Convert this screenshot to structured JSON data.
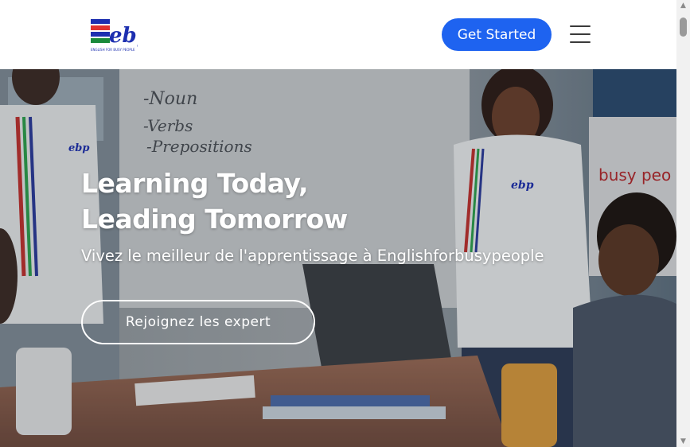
{
  "header": {
    "logo_text": "ebp",
    "logo_tagline": "ENGLISH FOR BUSY PEOPLE",
    "get_started_label": "Get Started",
    "menu_icon": "hamburger-menu-icon"
  },
  "hero": {
    "title_line1": "Learning Today,",
    "title_line2": "Leading Tomorrow",
    "subtitle": "Vivez le meilleur de l'apprentissage à Englishforbusypeople",
    "cta_label": "Rejoignez les expert",
    "whiteboard_words": [
      "-Noun",
      "-Verbs",
      "-Prepositions"
    ],
    "banner_text": "busy peo",
    "shirt_logo": "ebp"
  },
  "colors": {
    "primary_button": "#1e63f0",
    "logo_blue": "#1d2fb0",
    "logo_red": "#e0322f",
    "logo_green": "#1a8a3a"
  },
  "scrollbar": {
    "up_arrow": "▲",
    "down_arrow": "▼"
  }
}
